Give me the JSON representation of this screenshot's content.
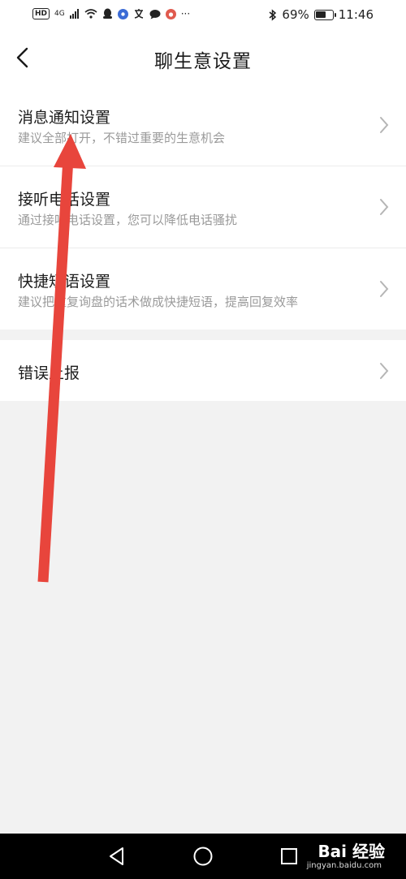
{
  "status_bar": {
    "network_badge": "HD",
    "network_type": "4G",
    "battery_percent": "69%",
    "battery_level": 0.69,
    "time": "11:46"
  },
  "header": {
    "title": "聊生意设置"
  },
  "settings": {
    "items": [
      {
        "title": "消息通知设置",
        "subtitle": "建议全部打开，不错过重要的生意机会"
      },
      {
        "title": "接听电话设置",
        "subtitle": "通过接听电话设置，您可以降低电话骚扰"
      },
      {
        "title": "快捷短语设置",
        "subtitle": "建议把重复询盘的话术做成快捷短语，提高回复效率"
      }
    ],
    "report": {
      "title": "错误上报"
    }
  },
  "watermark": {
    "brand": "Bai 经验",
    "url": "jingyan.baidu.com"
  },
  "colors": {
    "annotation_arrow": "#e8453c",
    "chevron": "#b5b5b5",
    "nav_bar": "#000000"
  }
}
